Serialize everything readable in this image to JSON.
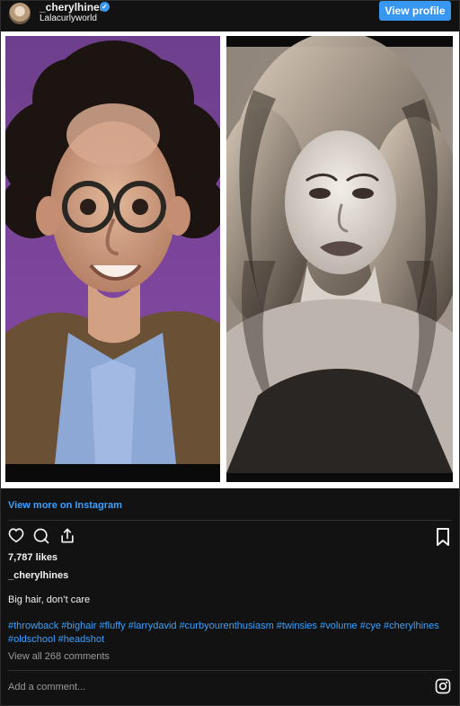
{
  "header": {
    "username": "_cherylhines",
    "verified_mark": "✓",
    "location": "Lalacurlyworld",
    "view_profile_label": "View profile"
  },
  "media": {
    "left_photo": {
      "icon": "portrait-man-curly-hair-glasses"
    },
    "right_photo": {
      "icon": "portrait-woman-curly-hair-bw"
    }
  },
  "post": {
    "view_more_label": "View more on Instagram",
    "likes": "7,787 likes",
    "username": "_cherylhines",
    "caption": "Big hair, don’t care",
    "hashtags_line1": "#throwback #bighair #fluffy #larrydavid #curbyourenthusiasm #twinsies #volume #cye #cherylhines",
    "hashtags_line2": "#oldschool #headshot",
    "view_comments": "View all 268 comments",
    "add_comment_placeholder": "Add a comment..."
  },
  "icons": {
    "like": "heart-icon",
    "comment": "comment-icon",
    "share": "share-icon",
    "save": "bookmark-icon",
    "instagram": "instagram-icon"
  },
  "colors": {
    "background": "#121212",
    "link": "#3aa0ff",
    "button": "#3897f0",
    "muted_text": "#9b9b9b"
  }
}
